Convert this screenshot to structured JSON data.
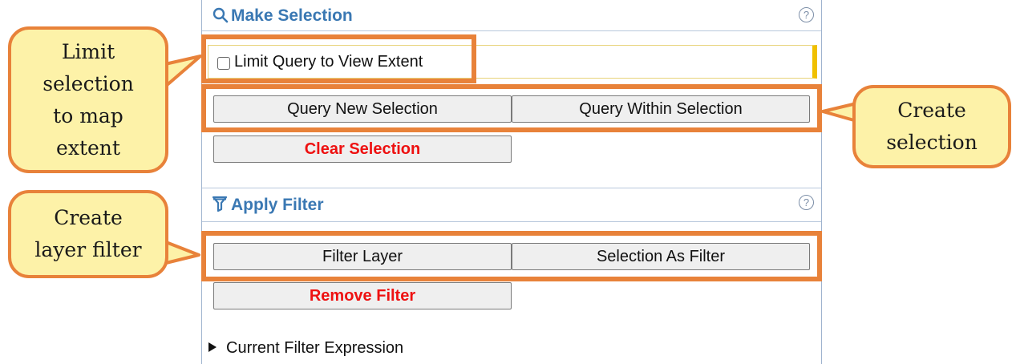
{
  "make_selection": {
    "title": "Make Selection",
    "icon": "search-icon",
    "help": "?",
    "limit_query_label": "Limit Query to View Extent",
    "limit_query_checked": false,
    "query_new_label": "Query New Selection",
    "query_within_label": "Query Within Selection",
    "clear_label": "Clear Selection"
  },
  "apply_filter": {
    "title": "Apply Filter",
    "icon": "filter-icon",
    "help": "?",
    "filter_layer_label": "Filter Layer",
    "selection_as_filter_label": "Selection As Filter",
    "remove_filter_label": "Remove Filter",
    "current_expression_label": "Current Filter Expression"
  },
  "callouts": {
    "limit": [
      "Limit",
      "selection",
      "to map",
      "extent"
    ],
    "create_selection": [
      "Create",
      "selection"
    ],
    "create_filter": [
      "Create",
      "layer filter"
    ]
  },
  "colors": {
    "accent_blue": "#3a78b3",
    "callout_fill": "#fdf2a8",
    "highlight_orange": "#e8823a",
    "danger_red": "#ee1111"
  }
}
